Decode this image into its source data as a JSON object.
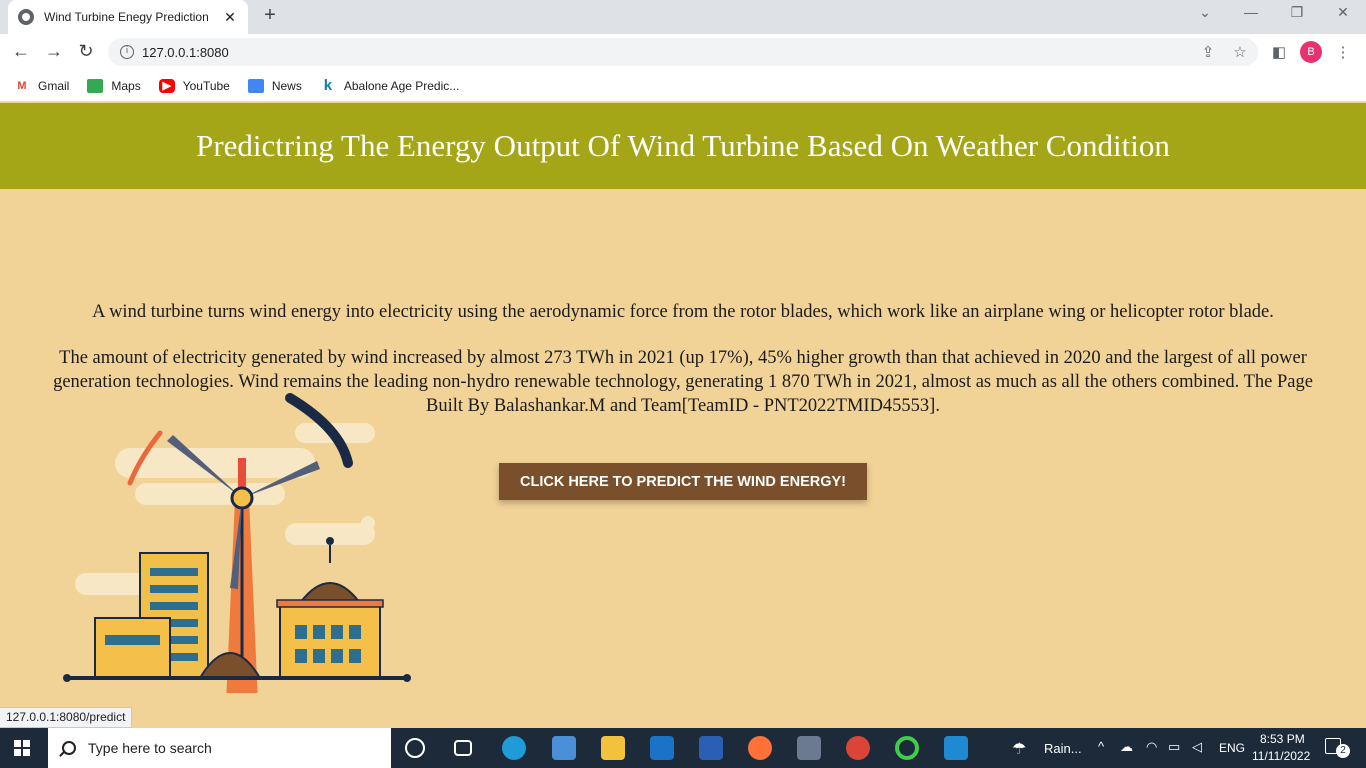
{
  "browser": {
    "tab_title": "Wind Turbine Enegy Prediction",
    "url": "127.0.0.1:8080",
    "status_url": "127.0.0.1:8080/predict",
    "profile_initial": "B",
    "bookmarks": [
      {
        "label": "Gmail",
        "icon": "gmail-icon"
      },
      {
        "label": "Maps",
        "icon": "maps-icon"
      },
      {
        "label": "YouTube",
        "icon": "youtube-icon"
      },
      {
        "label": "News",
        "icon": "news-icon"
      },
      {
        "label": "Abalone Age Predic...",
        "icon": "k-icon"
      }
    ]
  },
  "page": {
    "header_title": "Predictring The Energy Output Of Wind Turbine Based On Weather Condition",
    "paragraph_1": "A wind turbine turns wind energy into electricity using the aerodynamic force from the rotor blades, which work like an airplane wing or helicopter rotor blade.",
    "paragraph_2": "The amount of electricity generated by wind increased by almost 273 TWh in 2021 (up 17%), 45% higher growth than that achieved in 2020 and the largest of all power generation technologies. Wind remains the leading non-hydro renewable technology, generating 1 870 TWh in 2021, almost as much as all the others combined. The Page Built By Balashankar.M and Team[TeamID - PNT2022TMID45553].",
    "predict_button": "CLICK HERE TO PREDICT THE WIND ENERGY!",
    "colors": {
      "header_bg": "#a4a617",
      "page_bg": "#f1d297",
      "button_bg": "#7a4f2c"
    }
  },
  "taskbar": {
    "search_placeholder": "Type here to search",
    "weather": "Rain...",
    "language": "ENG",
    "time": "8:53 PM",
    "date": "11/11/2022",
    "notification_count": "2"
  }
}
